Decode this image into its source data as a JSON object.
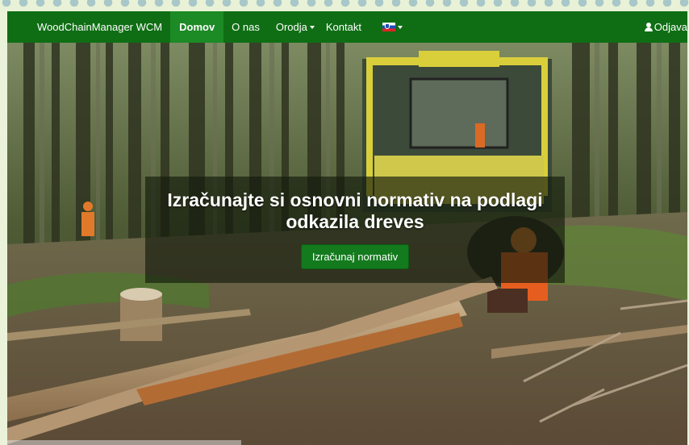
{
  "navbar": {
    "brand": "WoodChainManager WCM",
    "items": [
      {
        "label": "Domov",
        "active": true
      },
      {
        "label": "O nas"
      },
      {
        "label": "Orodja",
        "dropdown": true
      },
      {
        "label": "Kontakt"
      }
    ],
    "language_icon": "slovenia-flag-icon",
    "logout": {
      "icon": "user-icon",
      "label": "Odjava"
    }
  },
  "hero": {
    "image": "forest-logging-photo",
    "title": "Izračunajte si osnovni normativ na podlagi odkazila dreves",
    "button_label": "Izračunaj normativ"
  },
  "colors": {
    "navbar": "#0f6e14",
    "navbar_active": "#1c8a25",
    "button": "#137a1d",
    "page_border": "#a8c7c8"
  }
}
